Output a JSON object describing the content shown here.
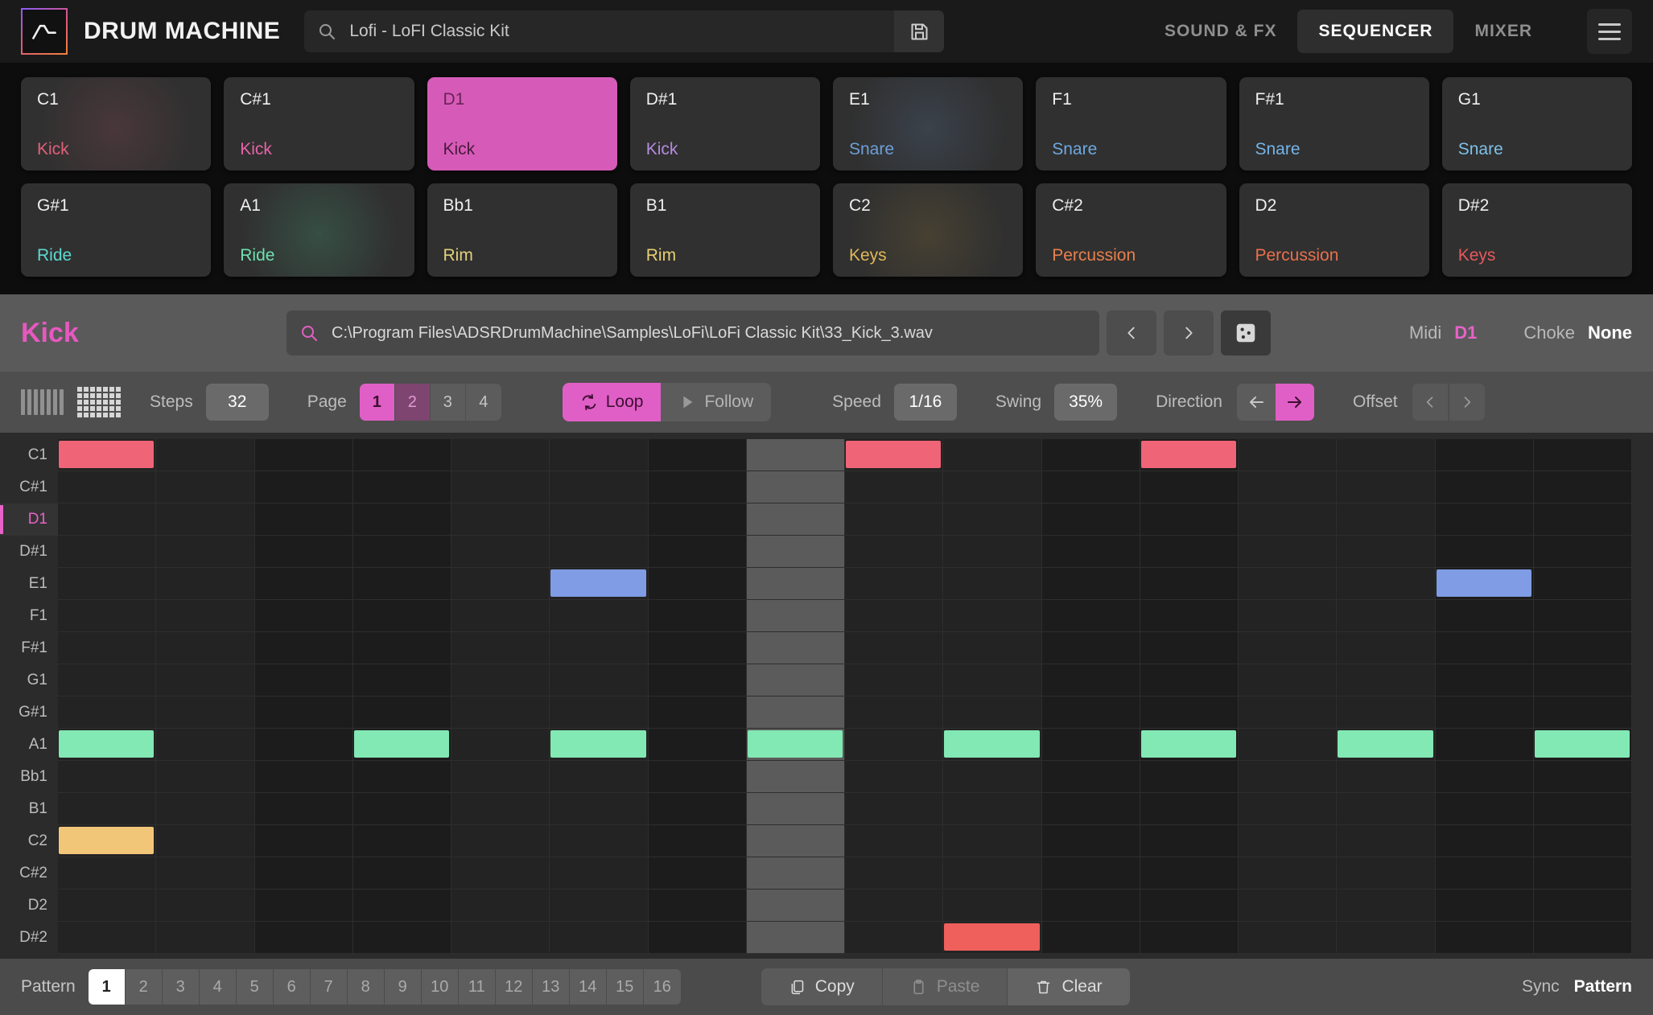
{
  "app": {
    "brand": "DRUM MACHINE",
    "logo_icon": "adsr-waveform-logo"
  },
  "search": {
    "value": "Lofi - LoFI Classic Kit",
    "icon": "search-icon",
    "save_icon": "save-disk-icon"
  },
  "nav": {
    "tabs": [
      {
        "label": "SOUND & FX",
        "active": false
      },
      {
        "label": "SEQUENCER",
        "active": true
      },
      {
        "label": "MIXER",
        "active": false
      }
    ],
    "menu_icon": "hamburger-menu-icon"
  },
  "pads": {
    "row1": [
      {
        "note": "C1",
        "inst": "Kick",
        "color": "#e0607a",
        "selected": false,
        "glow": "rgba(224,96,122,0.14)"
      },
      {
        "note": "C#1",
        "inst": "Kick",
        "color": "#e664a8",
        "selected": false,
        "glow": "none"
      },
      {
        "note": "D1",
        "inst": "Kick",
        "color": "#4a1a3c",
        "selected": true,
        "glow": "none"
      },
      {
        "note": "D#1",
        "inst": "Kick",
        "color": "#b48ce0",
        "selected": false,
        "glow": "none"
      },
      {
        "note": "E1",
        "inst": "Snare",
        "color": "#6e9fd8",
        "selected": false,
        "glow": "rgba(110,159,216,0.16)"
      },
      {
        "note": "F1",
        "inst": "Snare",
        "color": "#6ea8e0",
        "selected": false,
        "glow": "none"
      },
      {
        "note": "F#1",
        "inst": "Snare",
        "color": "#74b4e8",
        "selected": false,
        "glow": "none"
      },
      {
        "note": "G1",
        "inst": "Snare",
        "color": "#7ec0e8",
        "selected": false,
        "glow": "none"
      }
    ],
    "row2": [
      {
        "note": "G#1",
        "inst": "Ride",
        "color": "#5fd8d0",
        "selected": false,
        "glow": "none"
      },
      {
        "note": "A1",
        "inst": "Ride",
        "color": "#6fe0b0",
        "selected": false,
        "glow": "rgba(80,200,150,0.20)"
      },
      {
        "note": "Bb1",
        "inst": "Rim",
        "color": "#e2d07a",
        "selected": false,
        "glow": "none"
      },
      {
        "note": "B1",
        "inst": "Rim",
        "color": "#e8cf72",
        "selected": false,
        "glow": "none"
      },
      {
        "note": "C2",
        "inst": "Keys",
        "color": "#e0b858",
        "selected": false,
        "glow": "rgba(190,150,60,0.16)"
      },
      {
        "note": "C#2",
        "inst": "Percussion",
        "color": "#e8804c",
        "selected": false,
        "glow": "none"
      },
      {
        "note": "D2",
        "inst": "Percussion",
        "color": "#e8704c",
        "selected": false,
        "glow": "none"
      },
      {
        "note": "D#2",
        "inst": "Keys",
        "color": "#e8585c",
        "selected": false,
        "glow": "none"
      }
    ]
  },
  "sample": {
    "instrument": "Kick",
    "path": "C:\\Program Files\\ADSRDrumMachine\\Samples\\LoFi\\LoFi Classic Kit\\33_Kick_3.wav",
    "search_icon": "search-icon",
    "prev_icon": "chevron-left-icon",
    "next_icon": "chevron-right-icon",
    "random_icon": "dice-icon",
    "midi_label": "Midi",
    "midi_value": "D1",
    "choke_label": "Choke",
    "choke_value": "None"
  },
  "toolbar": {
    "view_bars_icon": "bars-view-icon",
    "view_grid_icon": "grid-view-icon",
    "steps_label": "Steps",
    "steps_value": "32",
    "page_label": "Page",
    "pages": [
      {
        "label": "1",
        "state": "on"
      },
      {
        "label": "2",
        "state": "half"
      },
      {
        "label": "3",
        "state": "off"
      },
      {
        "label": "4",
        "state": "off"
      }
    ],
    "loop_label": "Loop",
    "loop_icon": "loop-icon",
    "loop_on": true,
    "follow_label": "Follow",
    "follow_icon": "play-triangle-icon",
    "follow_on": false,
    "speed_label": "Speed",
    "speed_value": "1/16",
    "swing_label": "Swing",
    "swing_value": "35%",
    "direction_label": "Direction",
    "direction_back_icon": "arrow-left-icon",
    "direction_fwd_icon": "arrow-right-icon",
    "direction": "forward",
    "offset_label": "Offset",
    "offset_prev_icon": "chevron-left-icon",
    "offset_next_icon": "chevron-right-icon"
  },
  "sequencer": {
    "rows": [
      "C1",
      "C#1",
      "D1",
      "D#1",
      "E1",
      "F1",
      "F#1",
      "G1",
      "G#1",
      "A1",
      "Bb1",
      "B1",
      "C2",
      "C#2",
      "D2",
      "D#2"
    ],
    "selected_row": "D1",
    "steps": 16,
    "playhead_step": 7,
    "notes": [
      {
        "row": "C1",
        "steps": [
          0,
          8,
          11
        ],
        "color": "#ef6476"
      },
      {
        "row": "E1",
        "steps": [
          5,
          14
        ],
        "color": "#7f9ce4"
      },
      {
        "row": "A1",
        "steps": [
          0,
          3,
          5,
          7,
          9,
          11,
          13,
          15
        ],
        "color": "#82e8b4"
      },
      {
        "row": "C2",
        "steps": [
          0
        ],
        "color": "#f2c679"
      },
      {
        "row": "D#2",
        "steps": [
          9
        ],
        "color": "#ef5f5c"
      }
    ]
  },
  "bottom": {
    "pattern_label": "Pattern",
    "patterns": [
      "1",
      "2",
      "3",
      "4",
      "5",
      "6",
      "7",
      "8",
      "9",
      "10",
      "11",
      "12",
      "13",
      "14",
      "15",
      "16"
    ],
    "active_pattern": "1",
    "copy_label": "Copy",
    "copy_icon": "copy-icon",
    "paste_label": "Paste",
    "paste_icon": "paste-icon",
    "clear_label": "Clear",
    "clear_icon": "trash-icon",
    "sync_label": "Sync",
    "sync_value": "Pattern"
  }
}
